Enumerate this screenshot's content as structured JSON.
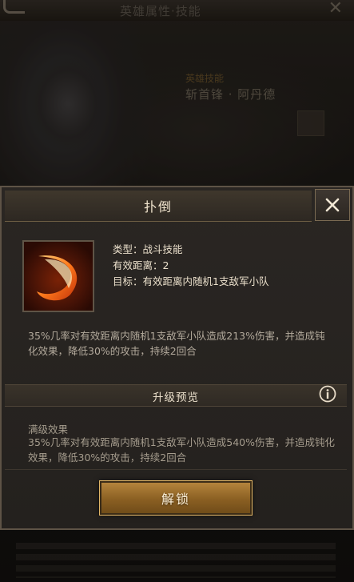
{
  "background": {
    "top_title": "英雄属性·技能",
    "skill_section_title": "英雄技能",
    "skill_name": "斩首锋 · 阿丹德"
  },
  "dialog": {
    "title": "扑倒",
    "type_line": "类型：战斗技能",
    "range_line": "有效距离：2",
    "target_line": "目标：有效距离内随机1支敌军小队",
    "description": "35%几率对有效距离内随机1支敌军小队造成213%伤害，并造成钝化效果，降低30%的攻击，持续2回合",
    "upgrade_preview_label": "升级预览",
    "max_level_title": "满级效果",
    "max_level_description": "35%几率对有效距离内随机1支敌军小队造成540%伤害，并造成钝化效果，降低30%的攻击，持续2回合",
    "unlock_label": "解锁"
  },
  "icons": {
    "close": "close-icon",
    "info": "info-icon",
    "skill": "crescent-slash-icon",
    "back": "back-arrow-icon"
  },
  "colors": {
    "accent_gold": "#b8873f",
    "dialog_bg": "#24211e",
    "text_primary": "#eadfcb"
  }
}
